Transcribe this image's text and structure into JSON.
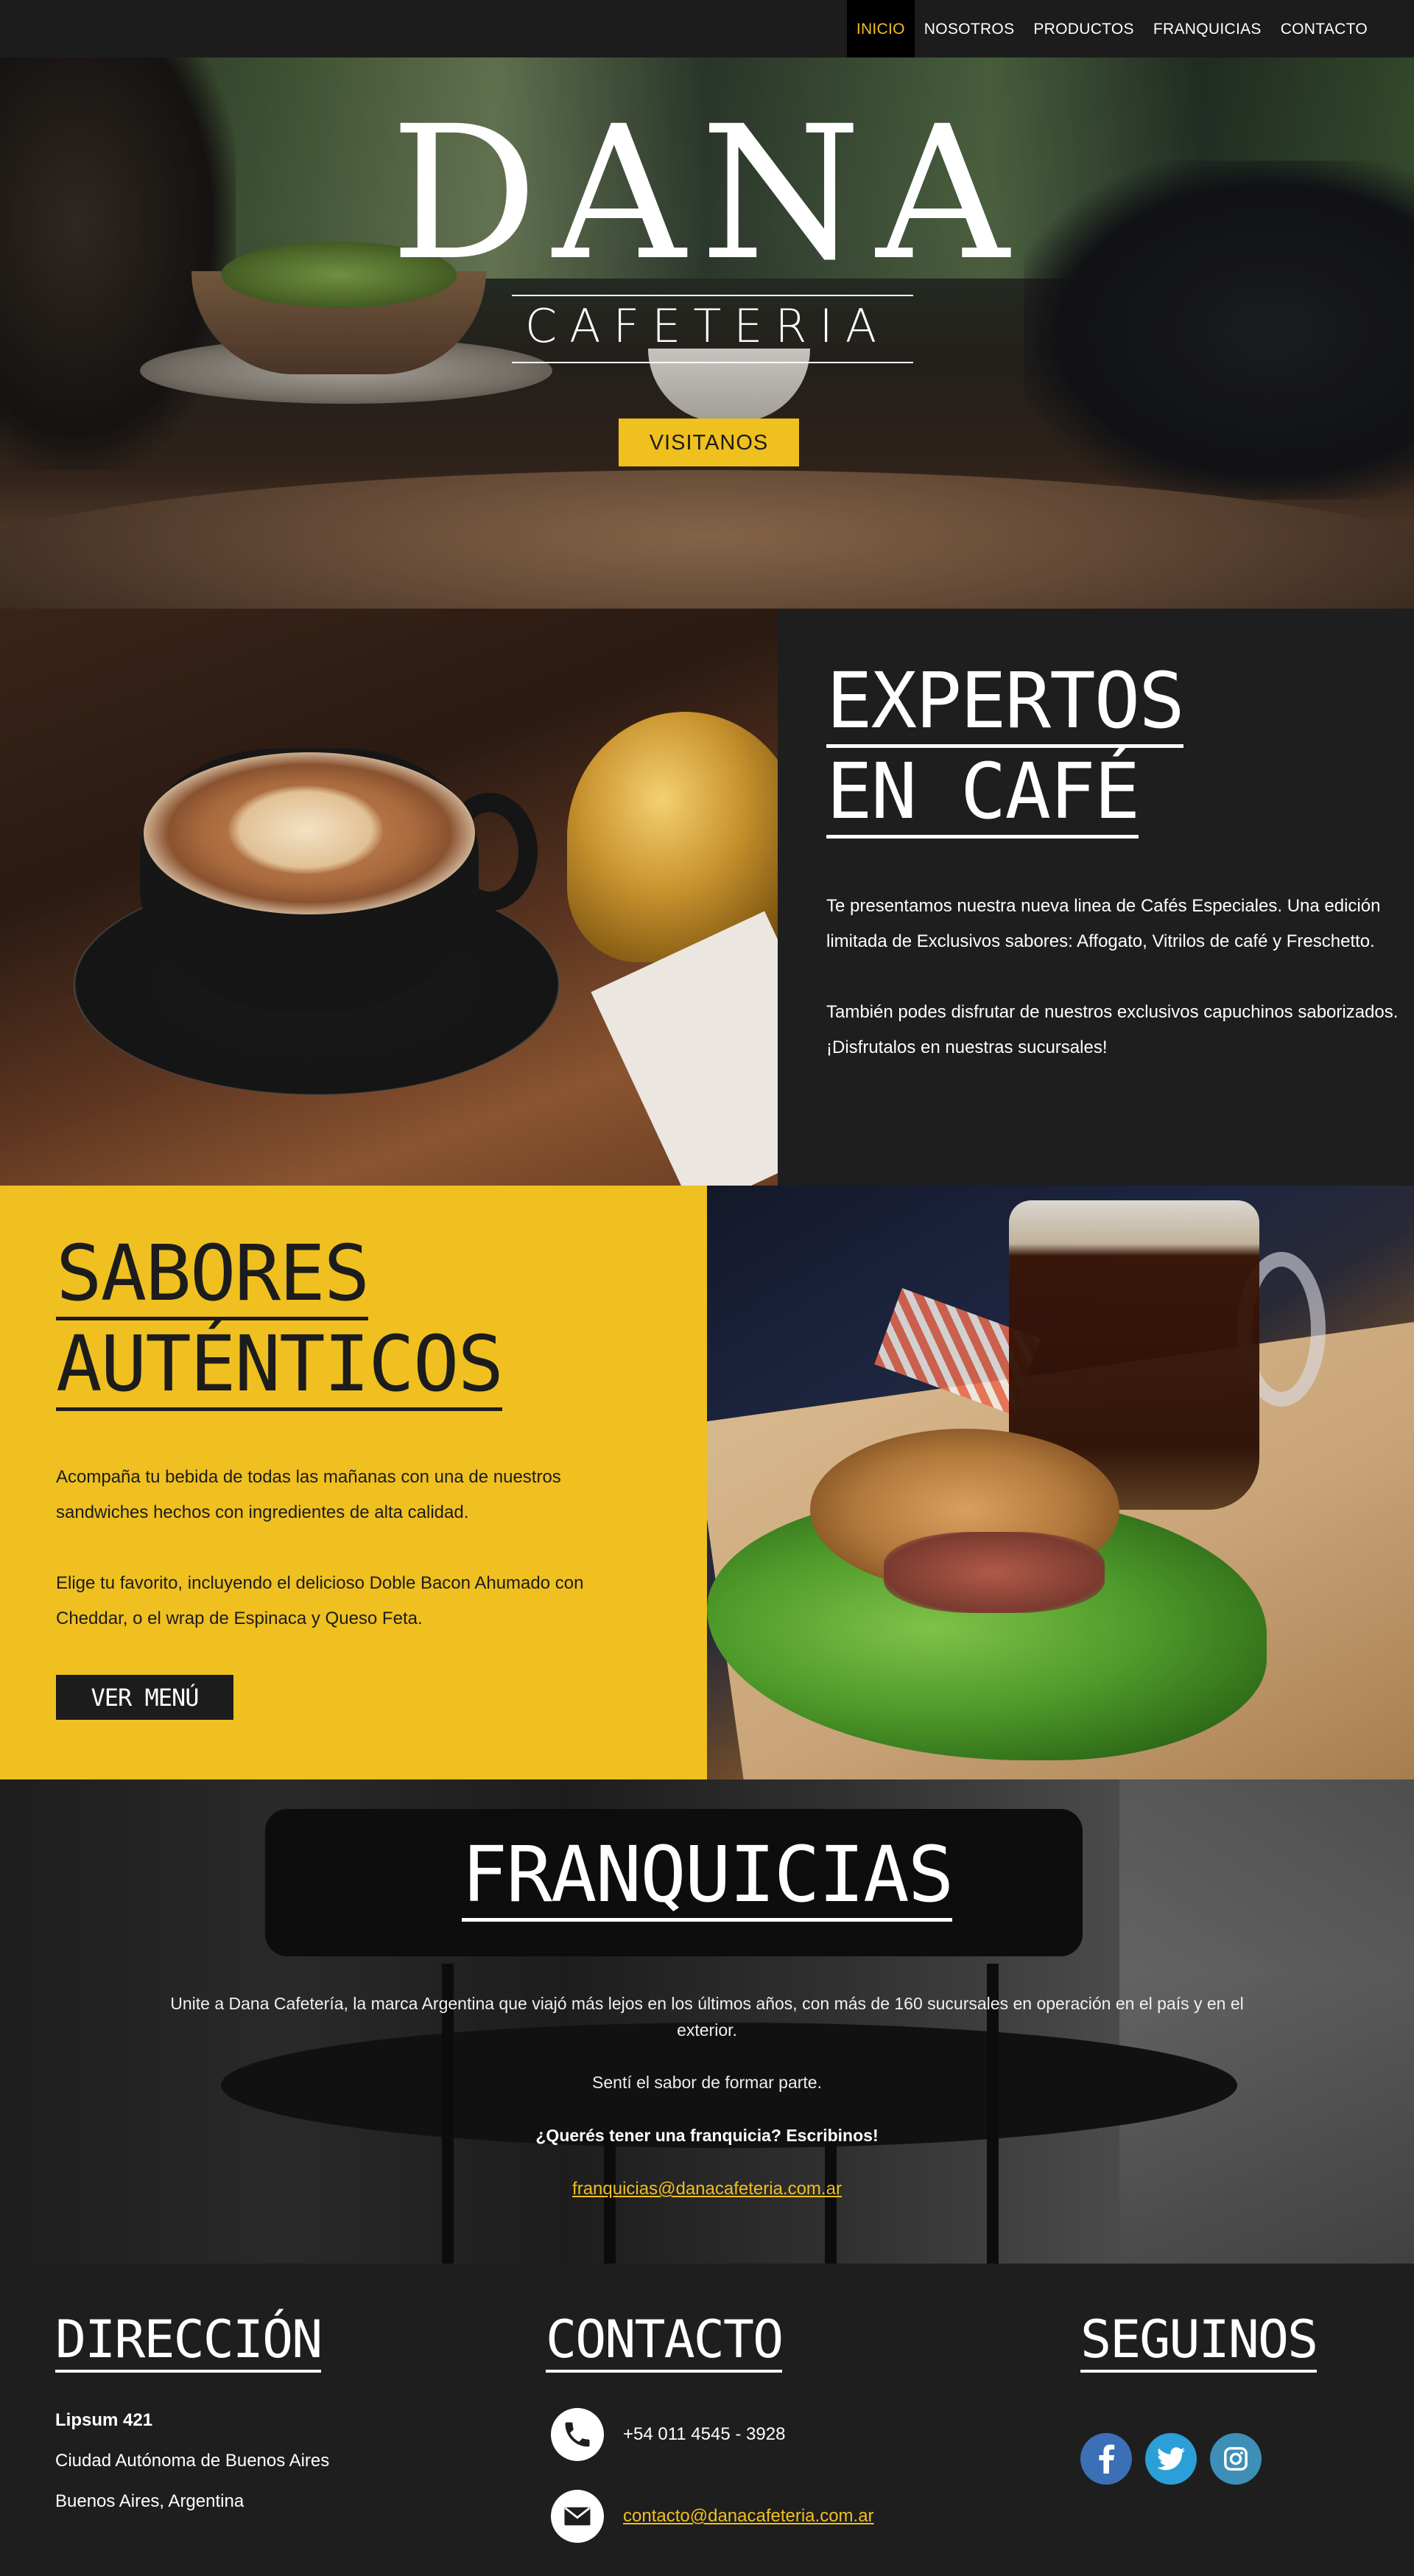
{
  "nav": {
    "items": [
      {
        "label": "INICIO",
        "active": true
      },
      {
        "label": "NOSOTROS",
        "active": false
      },
      {
        "label": "PRODUCTOS",
        "active": false
      },
      {
        "label": "FRANQUICIAS",
        "active": false
      },
      {
        "label": "CONTACTO",
        "active": false
      }
    ]
  },
  "hero": {
    "brand": "DANA",
    "subtitle": "CAFETERIA",
    "button_label": "VISITANOS"
  },
  "expertos": {
    "title_line1": "EXPERTOS",
    "title_line2": "EN CAFÉ",
    "paragraph1": "Te presentamos nuestra nueva linea de Cafés Especiales. Una edición limitada de Exclusivos sabores: Affogato, Vitrilos de café y Freschetto.",
    "paragraph2": "También podes disfrutar de nuestros exclusivos capuchinos saborizados. ¡Disfrutalos en nuestras sucursales!"
  },
  "sabores": {
    "title_line1": "SABORES",
    "title_line2": "AUTÉNTICOS",
    "paragraph1": "Acompaña tu bebida de todas las mañanas con una de nuestros sandwiches hechos con ingredientes de alta calidad.",
    "paragraph2": "Elige tu favorito, incluyendo el delicioso Doble Bacon Ahumado con Cheddar, o el wrap de Espinaca y Queso Feta.",
    "button_label": "VER MENÚ"
  },
  "franquicias": {
    "title": "FRANQUICIAS",
    "paragraph1": "Unite a Dana Cafetería, la marca Argentina que viajó más lejos en los últimos años, con más de 160 sucursales en operación en el país y en el exterior.",
    "paragraph2": "Sentí el sabor de formar parte.",
    "paragraph3": "¿Querés tener una franquicia? Escribinos!",
    "email": "franquicias@danacafeteria.com.ar"
  },
  "footer": {
    "direccion": {
      "title": "DIRECCIÓN",
      "line1": "Lipsum 421",
      "line2": "Ciudad Autónoma de Buenos Aires",
      "line3": "Buenos Aires, Argentina"
    },
    "contacto": {
      "title": "CONTACTO",
      "phone": "+54 011 4545 - 3928",
      "email": "contacto@danacafeteria.com.ar",
      "phone_icon": "phone-icon",
      "email_icon": "mail-icon"
    },
    "seguinos": {
      "title": "SEGUINOS",
      "networks": [
        {
          "name": "facebook-icon",
          "glyph": "f",
          "color": "#3b6fb6"
        },
        {
          "name": "twitter-icon",
          "glyph": "t",
          "color": "#2a9fd8"
        },
        {
          "name": "instagram-icon",
          "glyph": "ig",
          "color": "#3d8fb8"
        }
      ]
    }
  },
  "colors": {
    "accent": "#efc020",
    "dark": "#1e1e1e"
  }
}
